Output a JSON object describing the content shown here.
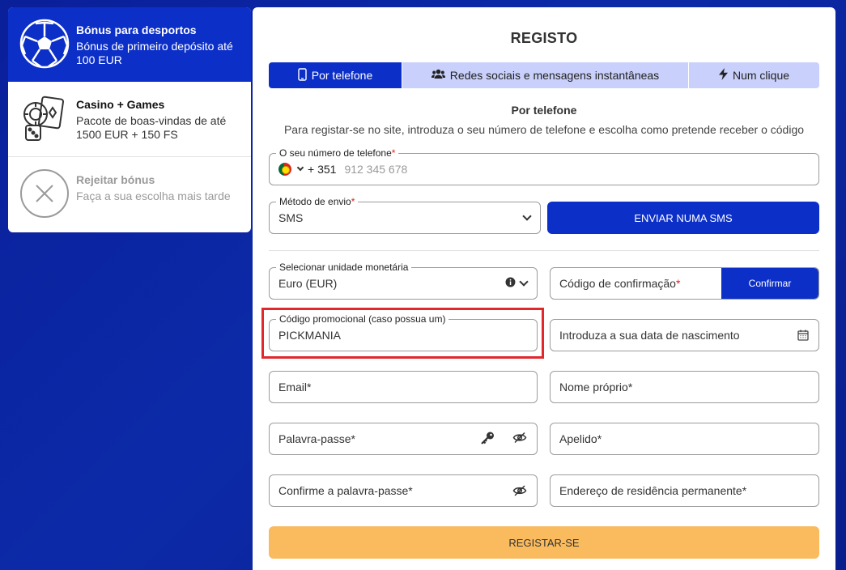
{
  "bonuses": [
    {
      "title": "Bónus para desportos",
      "desc": "Bónus de primeiro depósito até 100 EUR",
      "icon": "soccer-ball-icon"
    },
    {
      "title": "Casino + Games",
      "desc": "Pacote de boas-vindas de até 1500 EUR + 150 FS",
      "icon": "casino-chips-icon"
    },
    {
      "title": "Rejeitar bónus",
      "desc": "Faça a sua escolha mais tarde",
      "icon": "close-circle-icon"
    }
  ],
  "form": {
    "title": "REGISTO",
    "tabs": [
      {
        "label": "Por telefone",
        "icon": "phone-icon"
      },
      {
        "label": "Redes sociais e mensagens instantâneas",
        "icon": "users-icon"
      },
      {
        "label": "Num clique",
        "icon": "lightning-icon"
      }
    ],
    "subtitle": "Por telefone",
    "description": "Para registar-se no site, introduza o seu número de telefone e escolha como pretende receber o código",
    "phone": {
      "label": "O seu número de telefone",
      "code": "+ 351",
      "placeholder": "912 345 678"
    },
    "send_method": {
      "label": "Método de envio",
      "value": "SMS"
    },
    "send_button": "ENVIAR NUMA SMS",
    "currency": {
      "label": "Selecionar unidade monetária",
      "value": "Euro (EUR)"
    },
    "confirm_code": {
      "placeholder": "Código de confirmação",
      "button": "Confirmar"
    },
    "promo": {
      "label": "Código promocional (caso possua um)",
      "value": "PICKMANIA"
    },
    "birthdate": {
      "placeholder": "Introduza a sua data de nascimento"
    },
    "email": {
      "placeholder": "Email*"
    },
    "first_name": {
      "placeholder": "Nome próprio*"
    },
    "password": {
      "placeholder": "Palavra-passe*"
    },
    "last_name": {
      "placeholder": "Apelido*"
    },
    "confirm_password": {
      "placeholder": "Confirme a palavra-passe*"
    },
    "address": {
      "placeholder": "Endereço de residência permanente*"
    },
    "submit": "REGISTAR-SE"
  },
  "colors": {
    "primary": "#0c2fc8",
    "background": "#0a1f9a",
    "submit": "#f9bb5e",
    "highlight": "#e0282d"
  }
}
